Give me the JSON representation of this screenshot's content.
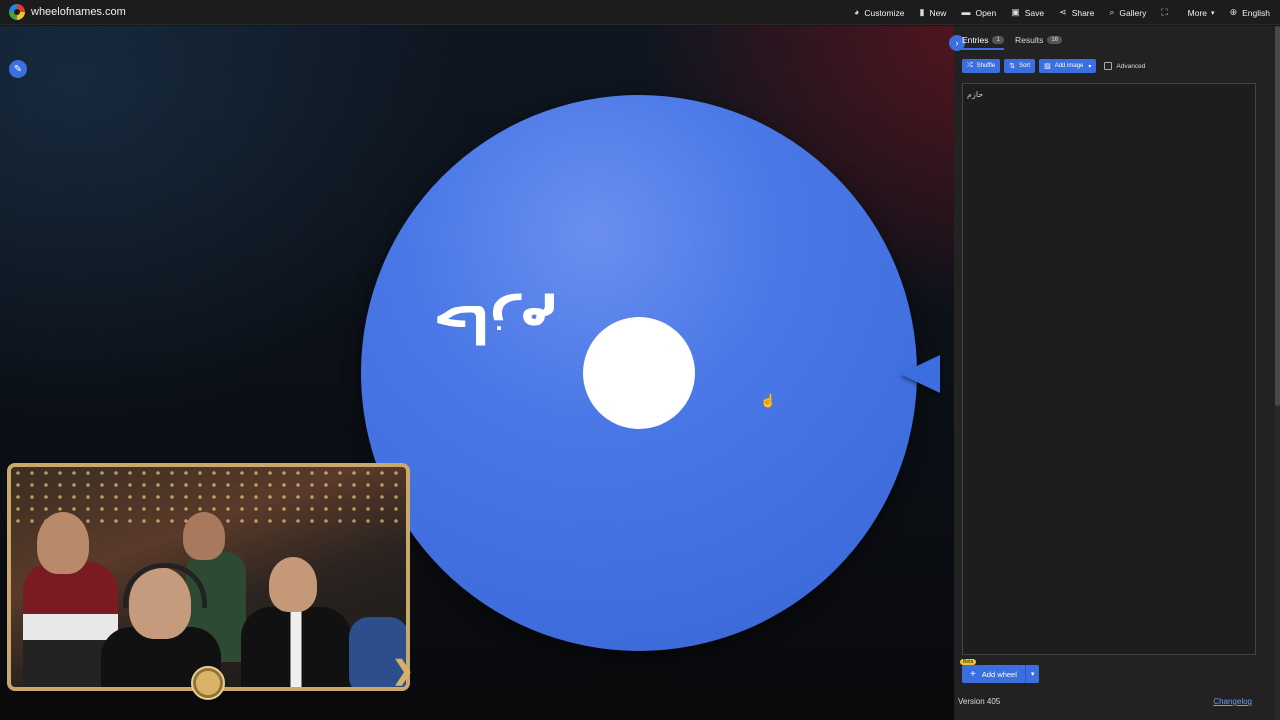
{
  "brand": {
    "name": "wheelofnames.com",
    "icon": "wheel-logo-icon"
  },
  "nav": [
    {
      "label": "Customize",
      "icon": "palette-icon",
      "glyph": "◕"
    },
    {
      "label": "New",
      "icon": "file-icon",
      "glyph": "▮"
    },
    {
      "label": "Open",
      "icon": "folder-icon",
      "glyph": "▬"
    },
    {
      "label": "Save",
      "icon": "save-icon",
      "glyph": "▣"
    },
    {
      "label": "Share",
      "icon": "share-icon",
      "glyph": "⋖"
    },
    {
      "label": "Gallery",
      "icon": "search-icon",
      "glyph": "⌕"
    },
    {
      "label": "",
      "icon": "fullscreen-icon",
      "glyph": "⛶"
    },
    {
      "label": "More",
      "icon": "chevron-down-icon",
      "glyph": "▾"
    },
    {
      "label": "English",
      "icon": "globe-icon",
      "glyph": "⊕"
    }
  ],
  "wheel": {
    "segment_label": "حازم",
    "color": "#4a78e6",
    "pointer_color": "#3b6fe0"
  },
  "panel": {
    "tabs": [
      {
        "label": "Entries",
        "count": "1"
      },
      {
        "label": "Results",
        "count": "16"
      }
    ],
    "toolbar": {
      "shuffle": "Shuffle",
      "sort": "Sort",
      "add_image": "Add image",
      "advanced": "Advanced"
    },
    "entries_text": "حازم",
    "add_wheel": {
      "label": "Add wheel",
      "badge": "Beta"
    },
    "version": "Version 405",
    "changelog": "Changelog"
  },
  "colors": {
    "accent": "#3b6fe0",
    "panel_bg": "#222222",
    "topbar_bg": "#1c1c1c"
  }
}
